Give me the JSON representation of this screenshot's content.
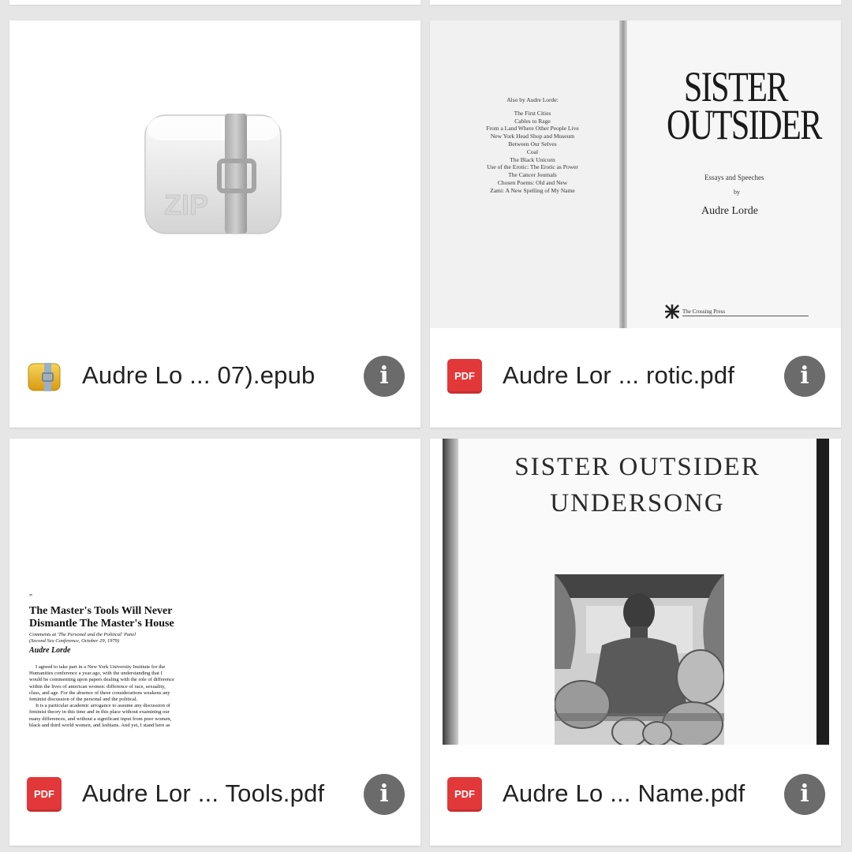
{
  "files": [
    {
      "name": "Audre Lo ... 07).epub",
      "type_icon": "archive-icon",
      "thumb_label": "ZIP"
    },
    {
      "name": "Audre Lor ... rotic.pdf",
      "type_icon": "pdf-icon",
      "type_label": "PDF",
      "thumb": {
        "also_by": "Also by Audre Lorde:",
        "titles": [
          "The First Cities",
          "Cables to Rage",
          "From a Land Where Other People Live",
          "New York Head Shop and Museum",
          "Between Our Selves",
          "Coal",
          "The Black Unicorn",
          "Use of the Erotic: The Erotic as Power",
          "The Cancer Journals",
          "Chosen Poems: Old and New",
          "Zami: A New Spelling of My Name"
        ],
        "title_line1": "SISTER",
        "title_line2": "OUTSIDER",
        "subtitle": "Essays and Speeches",
        "by": "by",
        "author": "Audre Lorde",
        "publisher": "The Crossing Press"
      }
    },
    {
      "name": "Audre Lor ... Tools.pdf",
      "type_icon": "pdf-icon",
      "type_label": "PDF",
      "thumb": {
        "quote_mark": "\"",
        "title_line1": "The Master's Tools Will Never",
        "title_line2": "Dismantle The Master's House",
        "comment1": "Comments at 'The Personal and the Political' Panel",
        "comment2": "(Second Sex Conference, October 29, 1979)",
        "author": "Audre Lorde",
        "p1_1": "I agreed to take part in a New York University Institute for the",
        "p1_2": "Humanities conference a year ago, with the understanding that I",
        "p1_3": "would be commenting upon papers dealing with the role of difference",
        "p1_4": "within the lives of american women: difference of race, sexuality,",
        "p1_5": "class, and age. For the absence of these considerations weakens any",
        "p1_6": "feminist discussion of the personal and the political.",
        "p2_1": "It is a particular academic arrogance to assume any discussion of",
        "p2_2": "feminist theory in this time and in this place without examining our",
        "p2_3": "many differences, and without a significant input from poor women,",
        "p2_4": "black and third world women, and lesbians. And yet, I stand here as"
      }
    },
    {
      "name": "Audre Lo ... Name.pdf",
      "type_icon": "pdf-icon",
      "type_label": "PDF",
      "thumb": {
        "title_line1": "SISTER OUTSIDER",
        "title_line2": "UNDERSONG"
      }
    }
  ],
  "info_glyph": "i"
}
